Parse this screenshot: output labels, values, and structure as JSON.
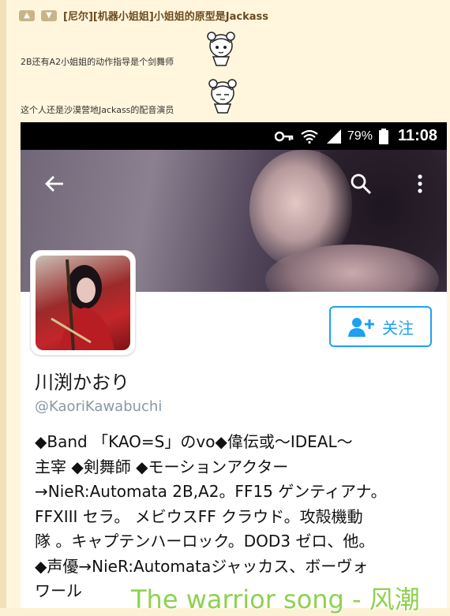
{
  "post": {
    "title": "[尼尔][机器小姐姐]小姐姐的原型是Jackass",
    "comment1": "2B还有A2小姐姐的动作指导是个剑舞师",
    "comment2": "这个人还是沙漠营地Jackass的配音演员"
  },
  "statusbar": {
    "battery_pct": "79%",
    "time": "11:08"
  },
  "profile": {
    "follow_label": "关注",
    "display_name": "川渕かおり",
    "handle": "@KaoriKawabuchi",
    "bio_lines": [
      "◆Band 「KAO=S」のvo◆偉伝或～IDEAL～",
      "主宰 ◆剣舞師 ◆モーションアクター",
      "→NieR:Automata 2B,A2。FF15 ゲンティアナ。",
      "FFXIII セラ。 メビウスFF クラウド。攻殻機動",
      "隊 。キャプテンハーロック。DOD3 ゼロ、他。",
      "◆声優→NieR:Automataジャッカス、ボーヴォ",
      "ワール"
    ]
  },
  "caption": "The warrior song - 风潮"
}
